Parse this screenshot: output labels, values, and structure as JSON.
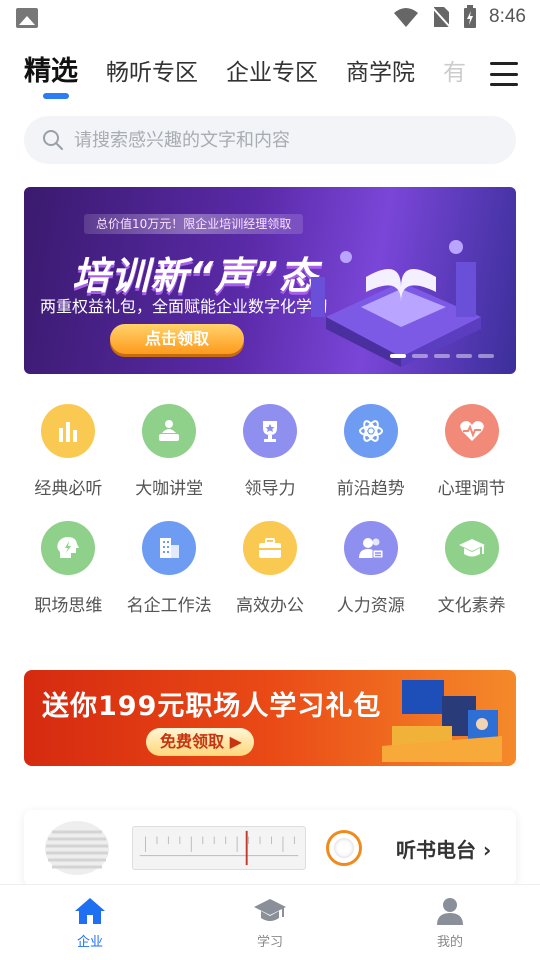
{
  "status_bar": {
    "time": "8:46"
  },
  "tabs": [
    {
      "label": "精选",
      "active": true
    },
    {
      "label": "畅听专区"
    },
    {
      "label": "企业专区"
    },
    {
      "label": "商学院"
    },
    {
      "label": "有"
    }
  ],
  "search": {
    "placeholder": "请搜索感兴趣的文字和内容"
  },
  "hero_banner": {
    "tagline": "总价值10万元！限企业培训经理领取",
    "headline": "培训新“声”态",
    "subtitle": "两重权益礼包，全面赋能企业数字化学习",
    "cta": "点击领取"
  },
  "categories": [
    {
      "label": "经典必听",
      "icon": "bar-chart-icon",
      "color": "#f9c952"
    },
    {
      "label": "大咖讲堂",
      "icon": "lecturer-icon",
      "color": "#8fd08a"
    },
    {
      "label": "领导力",
      "icon": "trophy-icon",
      "color": "#8f8ff0"
    },
    {
      "label": "前沿趋势",
      "icon": "atom-icon",
      "color": "#6d9cf2"
    },
    {
      "label": "心理调节",
      "icon": "heartbeat-icon",
      "color": "#f28a7a"
    },
    {
      "label": "职场思维",
      "icon": "head-bolt-icon",
      "color": "#8fd08a"
    },
    {
      "label": "名企工作法",
      "icon": "building-icon",
      "color": "#6d9cf2"
    },
    {
      "label": "高效办公",
      "icon": "briefcase-icon",
      "color": "#f9c952"
    },
    {
      "label": "人力资源",
      "icon": "people-icon",
      "color": "#8f8ff0"
    },
    {
      "label": "文化素养",
      "icon": "graduation-cap-icon",
      "color": "#8fd08a"
    }
  ],
  "promo_banner": {
    "title": "送你199元职场人学习礼包",
    "cta": "免费领取 ▶"
  },
  "radio_card": {
    "label": "听书电台 ›"
  },
  "bottom_nav": [
    {
      "label": "企业",
      "icon": "home-icon",
      "active": true
    },
    {
      "label": "学习",
      "icon": "graduation-cap-icon"
    },
    {
      "label": "我的",
      "icon": "user-icon"
    }
  ],
  "colors": {
    "accent": "#1f6ff2",
    "indicator": "#2c7cf6"
  }
}
